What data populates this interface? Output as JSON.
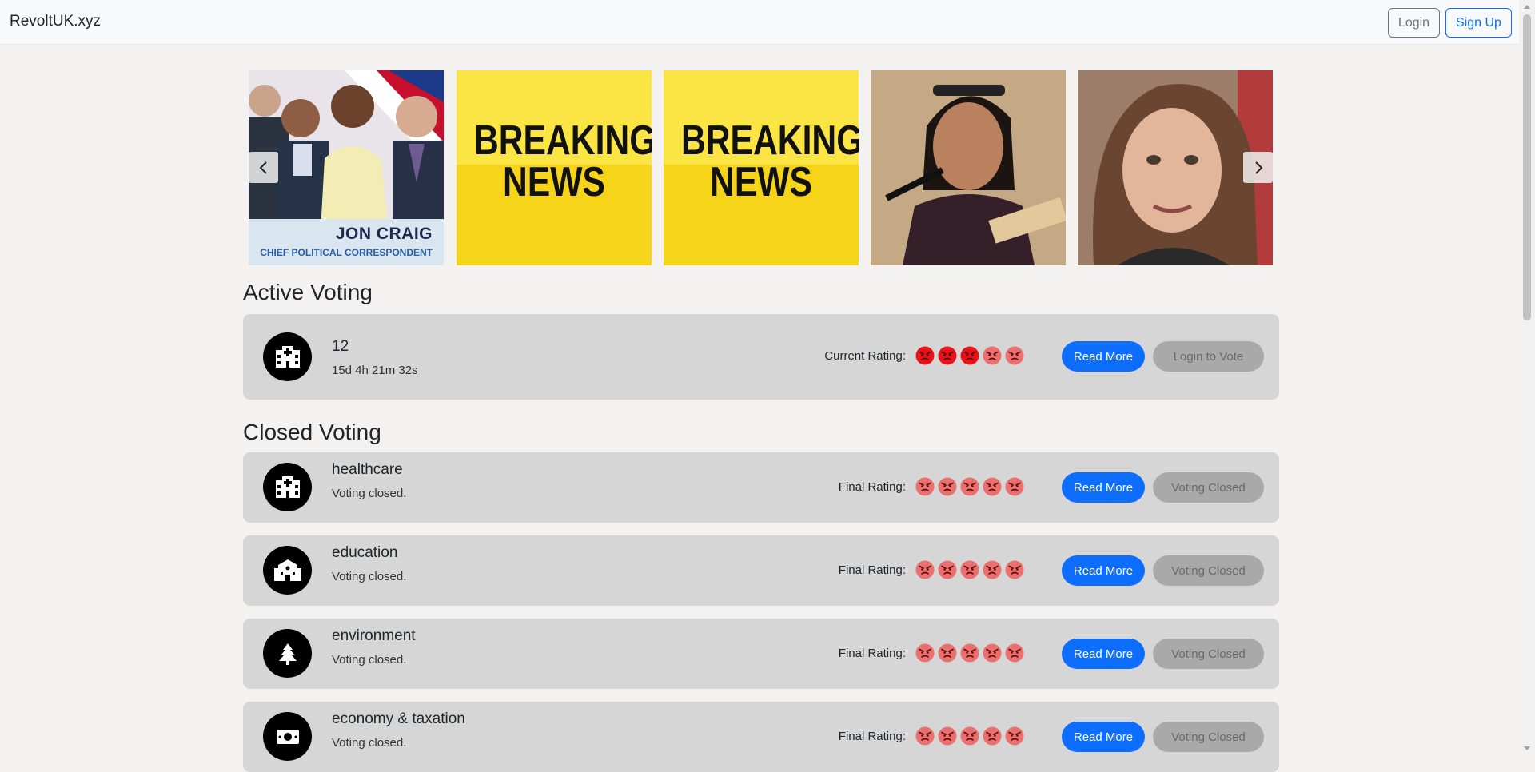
{
  "navbar": {
    "brand": "RevoltUK.xyz",
    "login_label": "Login",
    "signup_label": "Sign Up"
  },
  "carousel": {
    "slides": [
      {
        "kind": "photo",
        "caption_main": "JON CRAIG",
        "caption_sub": "CHIEF POLITICAL CORRESPONDENT"
      },
      {
        "kind": "banner",
        "line1": "BREAKING",
        "line2": "NEWS"
      },
      {
        "kind": "banner",
        "line1": "BREAKING",
        "line2": "NEWS"
      },
      {
        "kind": "photo"
      },
      {
        "kind": "photo"
      }
    ],
    "prev_icon": "chevron-left-icon",
    "next_icon": "chevron-right-icon"
  },
  "active_voting": {
    "heading": "Active Voting",
    "items": [
      {
        "title": "12",
        "subtitle": "15d 4h 21m 32s",
        "rating_label": "Current Rating:",
        "rating_value": 3,
        "rating_max": 5,
        "icon": "hospital-icon",
        "read_more": "Read More",
        "vote_label": "Login to Vote"
      }
    ]
  },
  "closed_voting": {
    "heading": "Closed Voting",
    "items": [
      {
        "title": "healthcare",
        "subtitle": "Voting closed.",
        "rating_label": "Final Rating:",
        "rating_value": 0,
        "rating_max": 5,
        "icon": "hospital-icon",
        "read_more": "Read More",
        "vote_label": "Voting Closed"
      },
      {
        "title": "education",
        "subtitle": "Voting closed.",
        "rating_label": "Final Rating:",
        "rating_value": 0,
        "rating_max": 5,
        "icon": "school-icon",
        "read_more": "Read More",
        "vote_label": "Voting Closed"
      },
      {
        "title": "environment",
        "subtitle": "Voting closed.",
        "rating_label": "Final Rating:",
        "rating_value": 0,
        "rating_max": 5,
        "icon": "tree-icon",
        "read_more": "Read More",
        "vote_label": "Voting Closed"
      },
      {
        "title": "economy & taxation",
        "subtitle": "Voting closed.",
        "rating_label": "Final Rating:",
        "rating_value": 0,
        "rating_max": 5,
        "icon": "money-icon",
        "read_more": "Read More",
        "vote_label": "Voting Closed"
      }
    ]
  },
  "colors": {
    "primary": "#0d6efd",
    "rating_active": "#e8121b",
    "rating_inactive": "#e9706f",
    "card_bg": "#d6d6d6"
  }
}
